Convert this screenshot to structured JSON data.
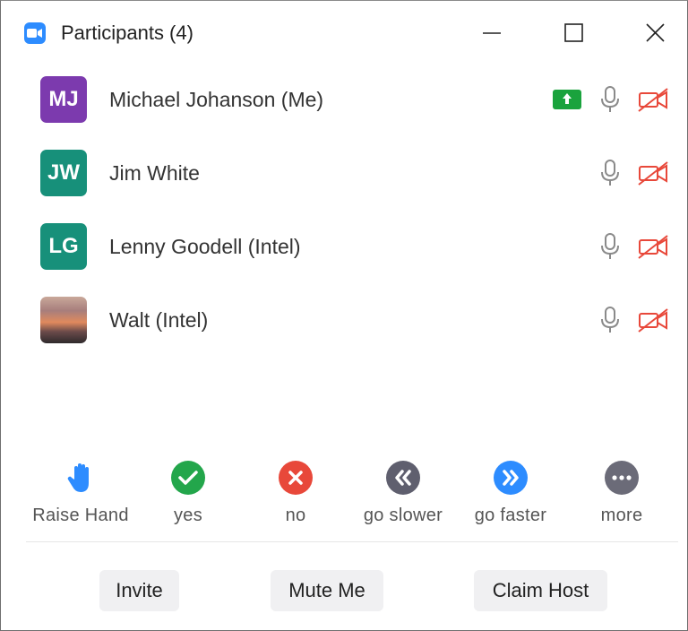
{
  "window": {
    "title": "Participants (4)"
  },
  "participants": [
    {
      "initials": "MJ",
      "name": "Michael Johanson (Me)",
      "avatar_color": "#7c3aae",
      "sharing": true,
      "avatar_type": "initials"
    },
    {
      "initials": "JW",
      "name": "Jim White",
      "avatar_color": "#17907a",
      "sharing": false,
      "avatar_type": "initials"
    },
    {
      "initials": "LG",
      "name": "Lenny Goodell (Intel)",
      "avatar_color": "#17907a",
      "sharing": false,
      "avatar_type": "initials"
    },
    {
      "initials": "",
      "name": "Walt (Intel)",
      "avatar_color": "",
      "sharing": false,
      "avatar_type": "photo"
    }
  ],
  "reactions": [
    {
      "label": "Raise Hand",
      "icon": "raise-hand-icon",
      "color": "#2d8cff"
    },
    {
      "label": "yes",
      "icon": "checkmark-icon",
      "color": "#23a64b"
    },
    {
      "label": "no",
      "icon": "x-icon",
      "color": "#e8483a"
    },
    {
      "label": "go slower",
      "icon": "rewind-icon",
      "color": "#5f5f6e"
    },
    {
      "label": "go faster",
      "icon": "fast-forward-icon",
      "color": "#2d8cff"
    },
    {
      "label": "more",
      "icon": "more-icon",
      "color": "#6b6b78"
    }
  ],
  "buttons": {
    "invite": "Invite",
    "mute_me": "Mute Me",
    "claim_host": "Claim Host"
  },
  "colors": {
    "share_green": "#1aa33d",
    "video_off_red": "#e8483a",
    "mic_gray": "#8a8a8a"
  }
}
